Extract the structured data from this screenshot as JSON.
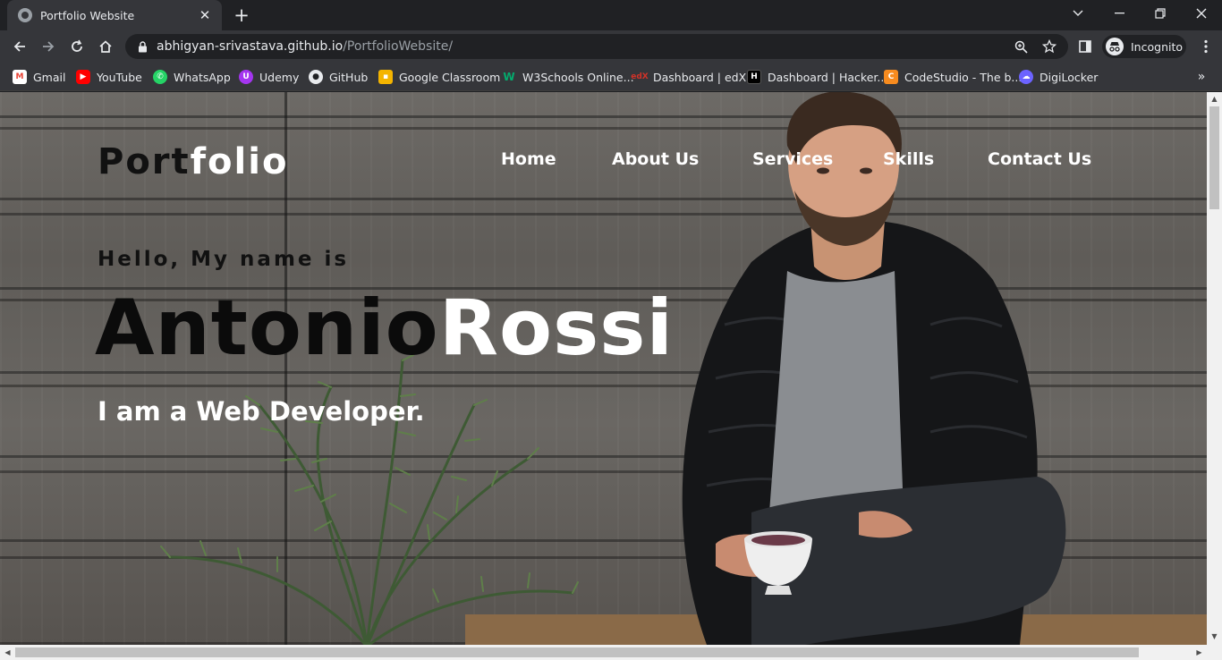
{
  "browser": {
    "tab_title": "Portfolio Website",
    "url_host": "abhigyan-srivastava.github.io",
    "url_path": "/PortfolioWebsite/",
    "profile_label": "Incognito"
  },
  "bookmarks": [
    {
      "label": "Gmail",
      "icon": "gmail-icon",
      "color": "#ea4335"
    },
    {
      "label": "YouTube",
      "icon": "youtube-icon",
      "color": "#ff0000"
    },
    {
      "label": "WhatsApp",
      "icon": "whatsapp-icon",
      "color": "#25d366"
    },
    {
      "label": "Udemy",
      "icon": "udemy-icon",
      "color": "#a435f0"
    },
    {
      "label": "GitHub",
      "icon": "github-icon",
      "color": "#e8eaed"
    },
    {
      "label": "Google Classroom",
      "icon": "classroom-icon",
      "color": "#f4b400"
    },
    {
      "label": "W3Schools Online...",
      "icon": "w3schools-icon",
      "color": "#04aa6d"
    },
    {
      "label": "Dashboard | edX",
      "icon": "edx-icon",
      "color": "#d23228"
    },
    {
      "label": "Dashboard | Hacker...",
      "icon": "hackerrank-icon",
      "color": "#000000"
    },
    {
      "label": "CodeStudio - The b...",
      "icon": "codestudio-icon",
      "color": "#f78b1f"
    },
    {
      "label": "DigiLocker",
      "icon": "digilocker-icon",
      "color": "#6c63ff"
    }
  ],
  "site": {
    "logo_part1": "Port",
    "logo_part2": "folio",
    "nav": [
      "Home",
      "About Us",
      "Services",
      "Skills",
      "Contact Us"
    ],
    "greeting": "Hello, My name is",
    "first_name": "Antonio",
    "last_name": "Rossi",
    "tagline": "I am a Web Developer."
  }
}
